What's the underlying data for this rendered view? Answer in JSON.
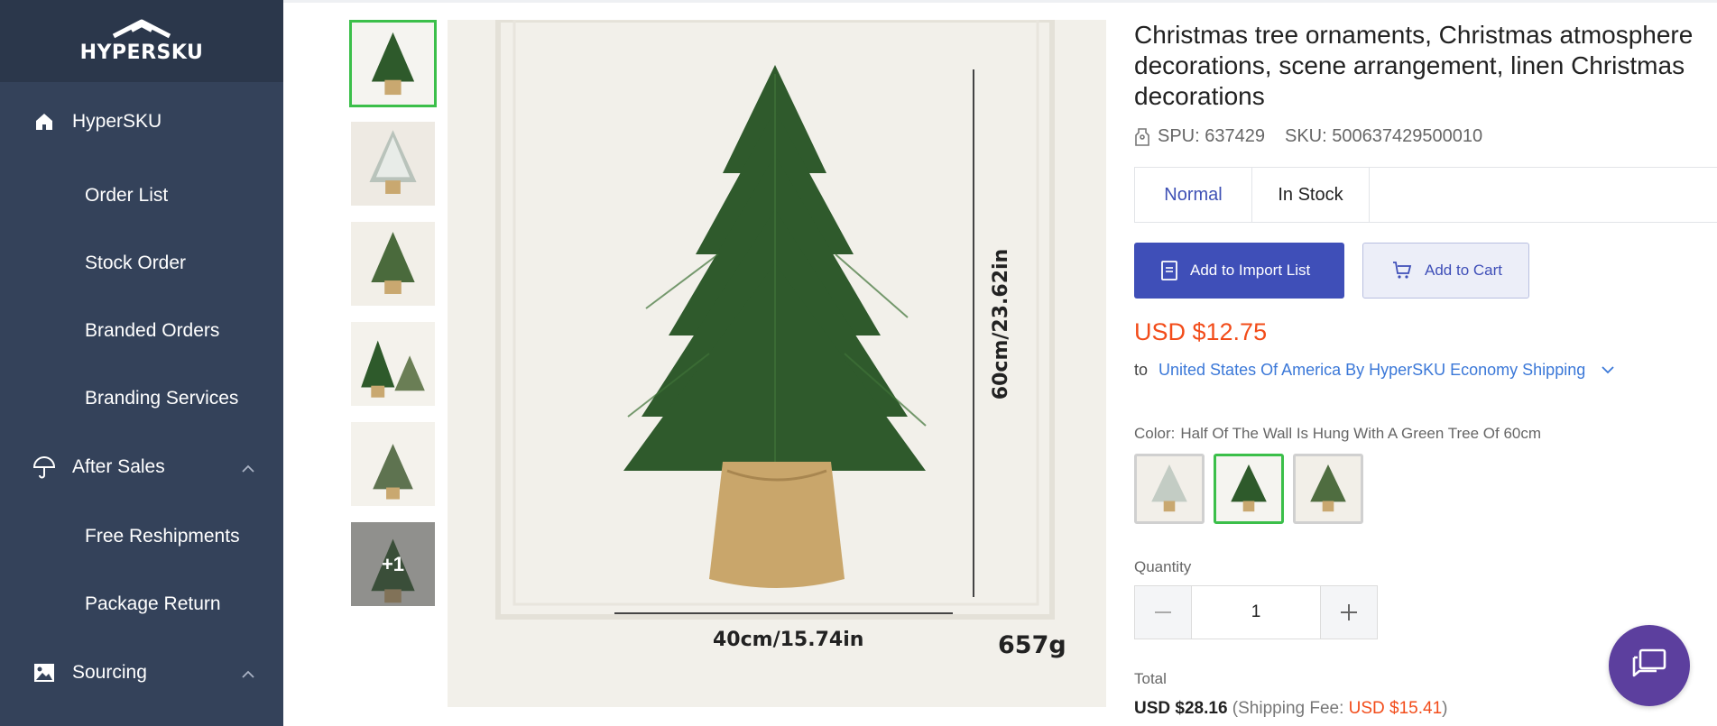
{
  "brand": {
    "logo_text": "HYPERSKU"
  },
  "sidebar": {
    "home": "HyperSKU",
    "items": [
      "Order List",
      "Stock Order",
      "Branded Orders",
      "Branding Services"
    ],
    "after_sales": {
      "label": "After Sales",
      "items": [
        "Free Reshipments",
        "Package Return"
      ]
    },
    "sourcing": {
      "label": "Sourcing"
    }
  },
  "thumbnails": {
    "more_count": "+1"
  },
  "main_image": {
    "height_label": "60cm/23.62in",
    "width_label": "40cm/15.74in",
    "weight_label": "657g"
  },
  "product": {
    "title_line1": "Christmas tree ornaments, Christmas atmosphere",
    "title_line2": "decorations, scene arrangement, linen Christmas",
    "title_line3": "decorations",
    "spu": "SPU: 637429",
    "sku": "SKU: 500637429500010",
    "tabs": [
      "Normal",
      "In Stock"
    ],
    "add_import": "Add to Import List",
    "add_cart": "Add to Cart",
    "price": "USD $12.75",
    "ship_to": "to",
    "ship_dest": "United States Of America By HyperSKU Economy Shipping",
    "color_label": "Color:",
    "color_value": "Half Of The Wall Is Hung With A Green Tree Of 60cm",
    "quantity_label": "Quantity",
    "quantity": "1",
    "total_label": "Total",
    "total_value": "USD $28.16",
    "fee_label": "(Shipping Fee:",
    "fee_value": "USD $15.41",
    "fee_close": ")"
  },
  "colors": {
    "accent": "#3f4fb8",
    "price": "#f24c1a",
    "sidebar": "#34425a",
    "selected": "#3bbf4a"
  }
}
